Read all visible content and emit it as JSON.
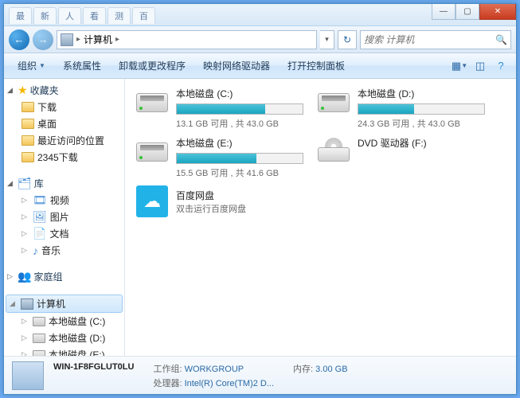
{
  "title_tabs": [
    "最",
    "新",
    "人",
    "看",
    "测",
    "百"
  ],
  "breadcrumb": {
    "item": "计算机"
  },
  "search": {
    "placeholder": "搜索 计算机"
  },
  "toolbar": {
    "organize": "组织",
    "sys_props": "系统属性",
    "uninstall": "卸载或更改程序",
    "map_drive": "映射网络驱动器",
    "control_panel": "打开控制面板"
  },
  "sidebar": {
    "favorites": {
      "label": "收藏夹",
      "items": [
        "下载",
        "桌面",
        "最近访问的位置",
        "2345下载"
      ]
    },
    "libraries": {
      "label": "库",
      "items": [
        "视频",
        "图片",
        "文档",
        "音乐"
      ]
    },
    "homegroup": {
      "label": "家庭组"
    },
    "computer": {
      "label": "计算机",
      "items": [
        "本地磁盘 (C:)",
        "本地磁盘 (D:)",
        "本地磁盘 (E:)"
      ]
    }
  },
  "drives": [
    {
      "name": "本地磁盘 (C:)",
      "sub": "13.1 GB 可用 , 共 43.0 GB",
      "fill": 70
    },
    {
      "name": "本地磁盘 (D:)",
      "sub": "24.3 GB 可用 , 共 43.0 GB",
      "fill": 44
    },
    {
      "name": "本地磁盘 (E:)",
      "sub": "15.5 GB 可用 , 共 41.6 GB",
      "fill": 63
    }
  ],
  "dvd": {
    "name": "DVD 驱动器 (F:)"
  },
  "app": {
    "name": "百度网盘",
    "sub": "双击运行百度网盘"
  },
  "status": {
    "computer_name": "WIN-1F8FGLUT0LU",
    "workgroup_label": "工作组:",
    "workgroup": "WORKGROUP",
    "cpu_label": "处理器:",
    "cpu": "Intel(R) Core(TM)2 D...",
    "mem_label": "内存:",
    "mem": "3.00 GB"
  }
}
